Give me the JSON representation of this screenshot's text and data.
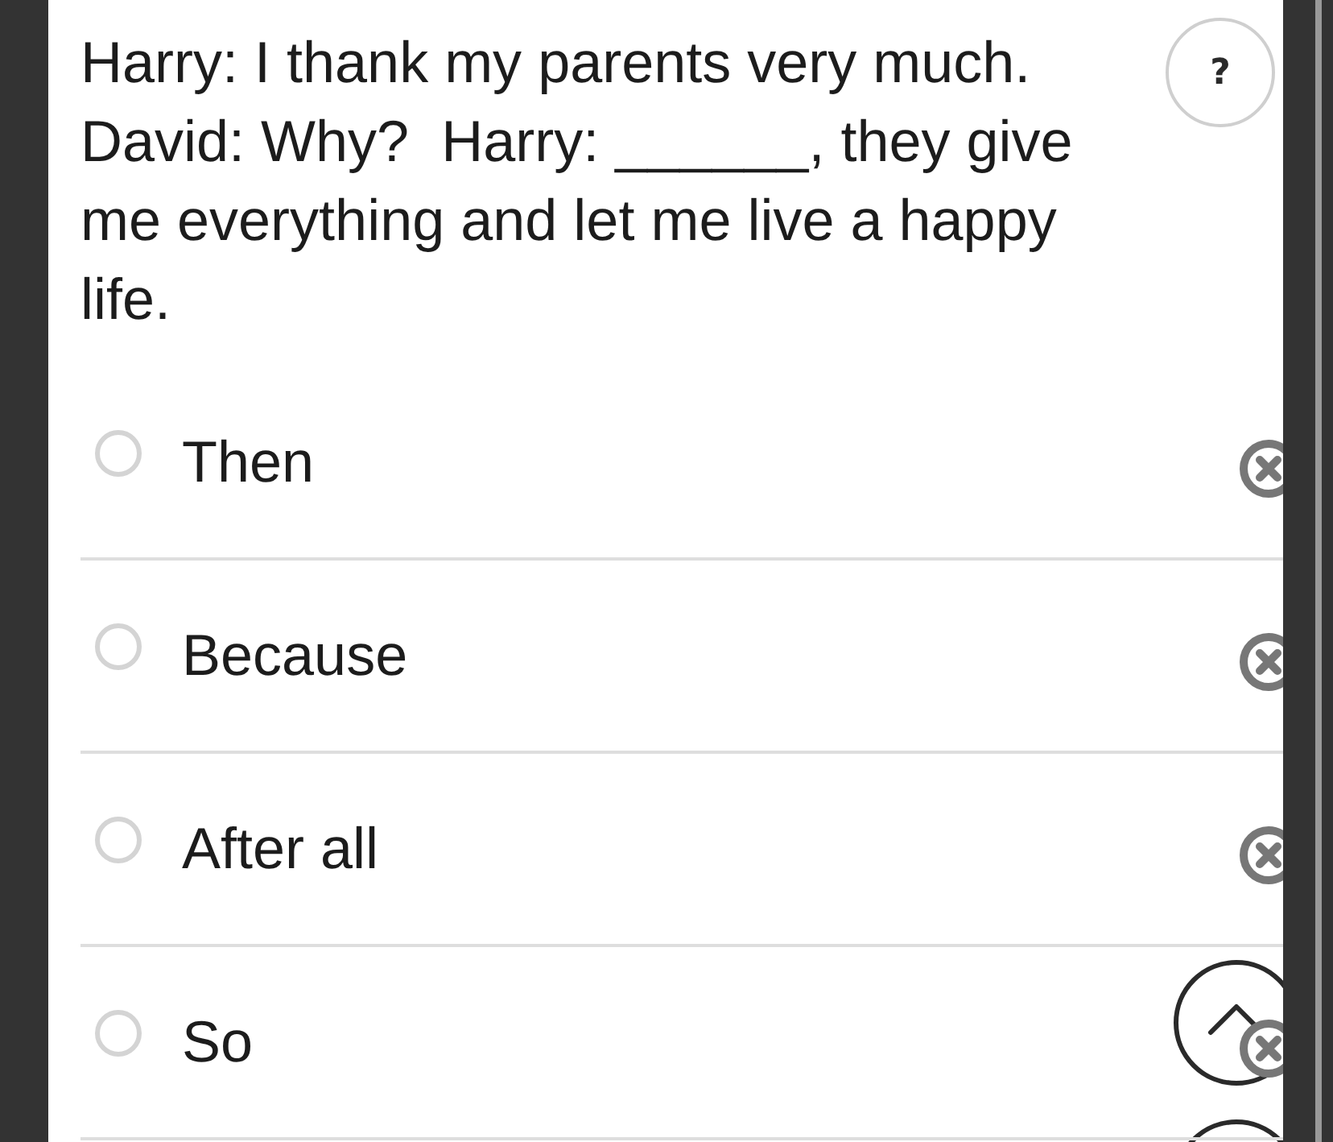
{
  "question": {
    "text": "Harry: I thank my parents very much. David: Why?  Harry: ______, they give me everything and let me live a happy life."
  },
  "help_button": {
    "label": "?"
  },
  "options": [
    {
      "label": "Then",
      "selected": false
    },
    {
      "label": "Because",
      "selected": false
    },
    {
      "label": "After all",
      "selected": false
    },
    {
      "label": "So",
      "selected": false
    }
  ]
}
